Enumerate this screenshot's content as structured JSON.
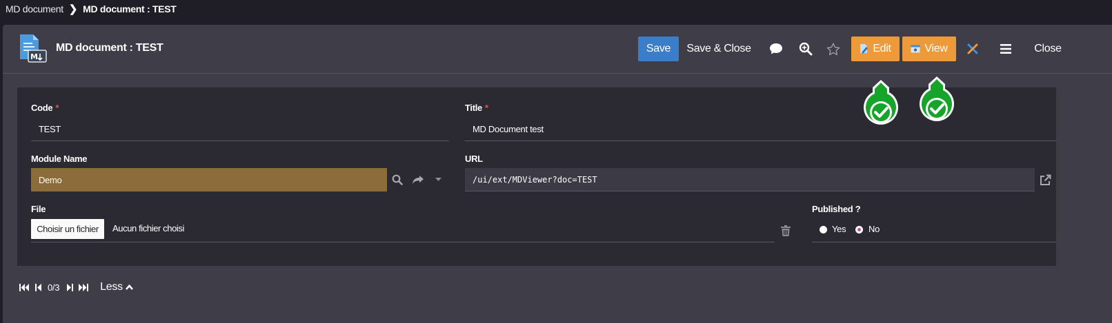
{
  "breadcrumb": {
    "parent": "MD document",
    "current": "MD document : TEST"
  },
  "header": {
    "title": "MD document : TEST"
  },
  "toolbar": {
    "save_label": "Save",
    "save_close_label": "Save & Close",
    "edit_label": "Edit",
    "view_label": "View",
    "close_label": "Close"
  },
  "form": {
    "code": {
      "label": "Code",
      "required": "*",
      "value": "TEST"
    },
    "title": {
      "label": "Title",
      "required": "*",
      "value": "MD Document test"
    },
    "module_name": {
      "label": "Module Name",
      "value": "Demo"
    },
    "url": {
      "label": "URL",
      "value": "/ui/ext/MDViewer?doc=TEST"
    },
    "file": {
      "label": "File",
      "button_label": "Choisir un fichier",
      "status": "Aucun fichier choisi"
    },
    "published": {
      "label": "Published ?",
      "options": [
        "Yes",
        "No"
      ],
      "selected": "No"
    }
  },
  "pager": {
    "position": "0/3",
    "less_label": "Less"
  },
  "colors": {
    "accent_blue": "#3a7dc9",
    "accent_orange": "#ec9a3a",
    "module_field": "#8b6c3a",
    "marker_green": "#16a52a"
  }
}
